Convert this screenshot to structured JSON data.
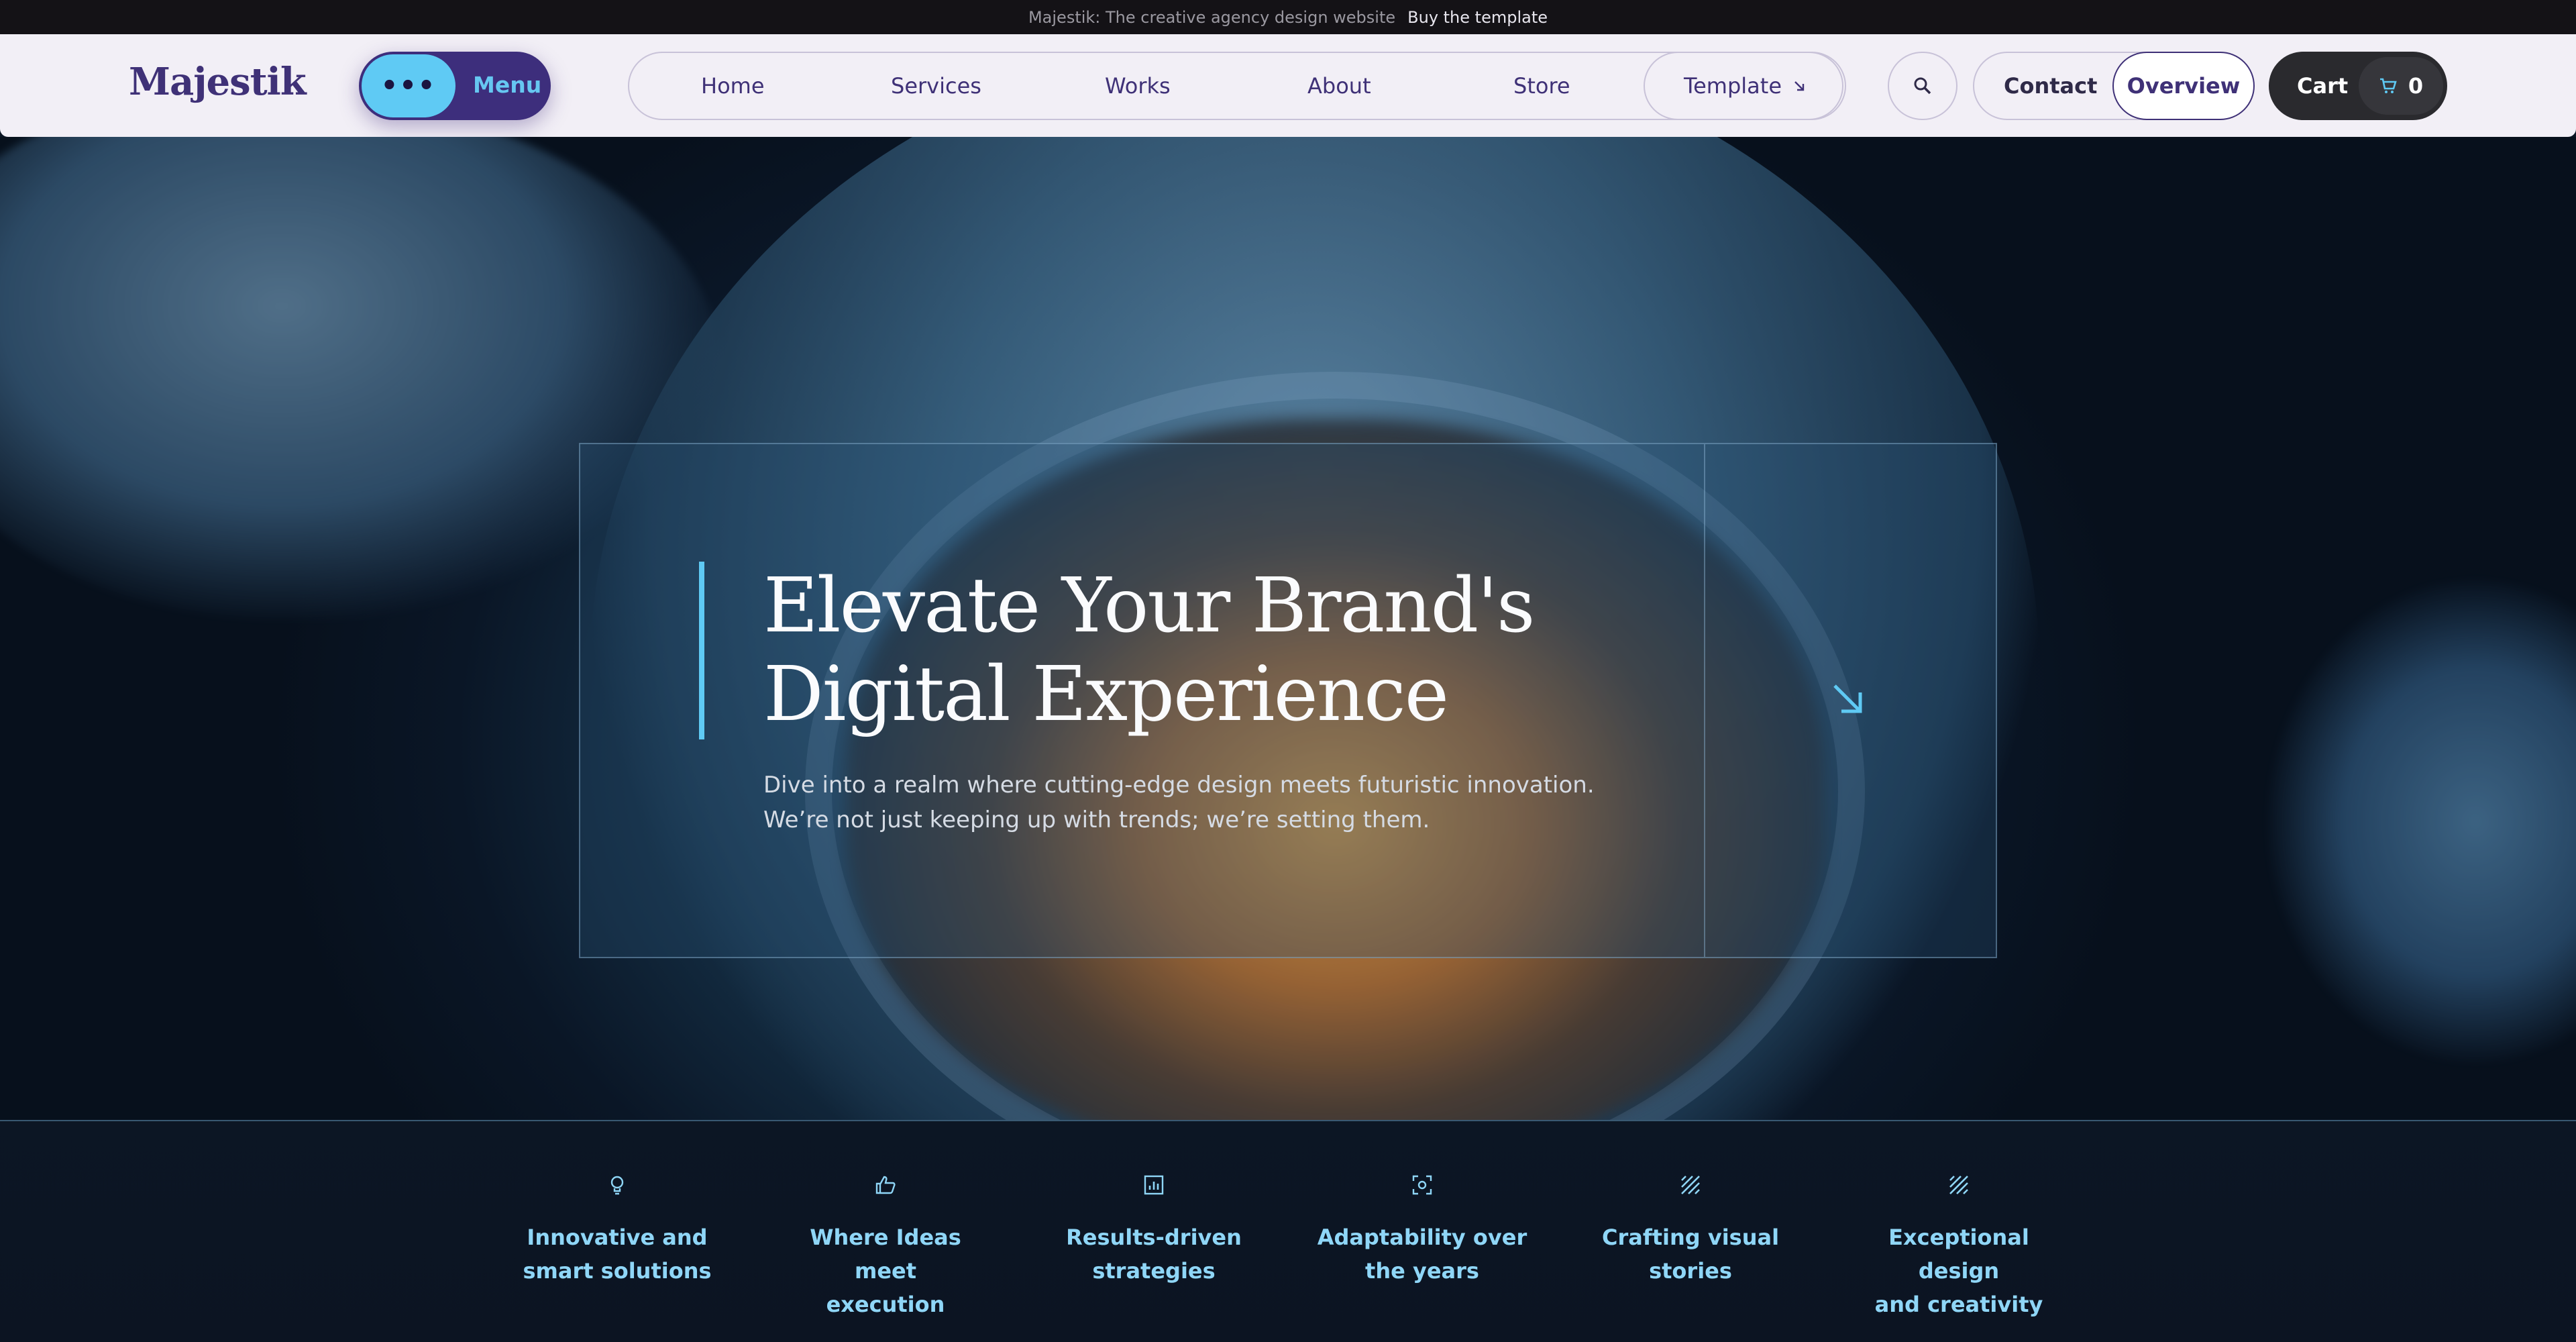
{
  "topbar": {
    "announcement": "Majestik: The creative agency design website",
    "cta": "Buy the template"
  },
  "header": {
    "logo": "Majestik",
    "menu_label": "Menu",
    "nav": [
      {
        "label": "Home"
      },
      {
        "label": "Services"
      },
      {
        "label": "Works"
      },
      {
        "label": "About"
      },
      {
        "label": "Store"
      }
    ],
    "template_label": "Template",
    "contact_label": "Contact",
    "overview_label": "Overview",
    "cart_label": "Cart",
    "cart_count": "0"
  },
  "hero": {
    "headline_line1": "Elevate Your Brand's",
    "headline_line2": "Digital Experience",
    "sub_line1": "Dive into a realm where cutting-edge design meets futuristic innovation.",
    "sub_line2": "We’re not just keeping up with trends; we’re setting them."
  },
  "features": [
    {
      "icon": "lightbulb-icon",
      "line1": "Innovative and",
      "line2": "smart solutions"
    },
    {
      "icon": "thumbs-up-icon",
      "line1": "Where Ideas meet",
      "line2": "execution"
    },
    {
      "icon": "chart-icon",
      "line1": "Results-driven",
      "line2": "strategies"
    },
    {
      "icon": "focus-icon",
      "line1": "Adaptability over",
      "line2": "the years"
    },
    {
      "icon": "hatch-icon",
      "line1": "Crafting visual",
      "line2": "stories"
    },
    {
      "icon": "hatch-icon",
      "line1": "Exceptional design",
      "line2": "and creativity"
    }
  ],
  "colors": {
    "brand": "#3f3177",
    "accent": "#5fcaf4",
    "feature_text": "#8fd6f7"
  }
}
